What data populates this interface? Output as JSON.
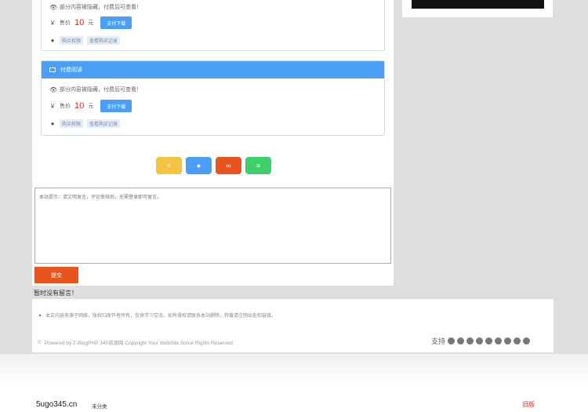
{
  "card1": {
    "desc": "部分内容被隐藏，付费后可查看！",
    "price_label": "售价",
    "price_value": "10",
    "price_unit": "元",
    "buy_label": "支付下载",
    "tags": [
      "购买权限",
      "查看购买记录"
    ]
  },
  "card2": {
    "title": "付费阅读",
    "desc": "部分内容被隐藏，付费后可查看！",
    "price_label": "售价",
    "price_value": "10",
    "price_unit": "元",
    "buy_label": "支付下载",
    "tags": [
      "购买权限",
      "查看购买记录"
    ]
  },
  "share": [
    {
      "icon": "share-icon",
      "glyph": "<",
      "color": "#f5c342"
    },
    {
      "icon": "qq-icon",
      "glyph": "●",
      "color": "#4a9ef5"
    },
    {
      "icon": "weibo-icon",
      "glyph": "∞",
      "color": "#e8541e"
    },
    {
      "icon": "wechat-icon",
      "glyph": "≡",
      "color": "#3fcf6a"
    }
  ],
  "comment": {
    "placeholder": "本站提示：请文明发言，评论审核后，无需登录即可留言。",
    "submit_label": "提交"
  },
  "section_title": "暂时没有留言！",
  "footer": {
    "notice": "本文内容来源于网络，版权归原作者所有，仅供学习交流。如有侵权请联系本站删除，转载请注明出处和链接。",
    "powered": "Powered by Z-BlogPHP 345资源网 Copyright Your WebSite.Some Rights Reserved.",
    "support_label": "支持"
  },
  "bottom": {
    "brand": "5ugo345.cn",
    "unsorted": "未分类",
    "old_version": "旧版"
  },
  "colors": {
    "accent": "#4a9ef5",
    "price": "#e1251b",
    "submit": "#e8541e"
  }
}
